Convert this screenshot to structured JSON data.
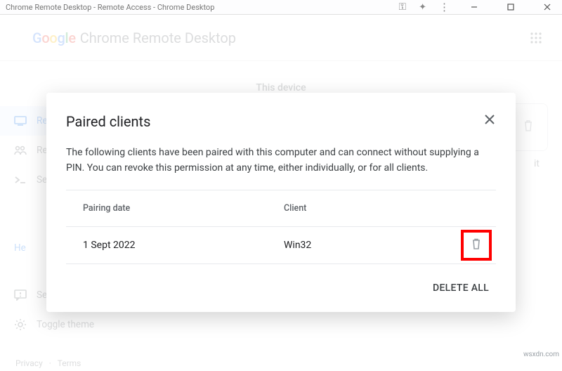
{
  "window": {
    "title": "Chrome Remote Desktop - Remote Access - Chrome Desktop"
  },
  "header": {
    "google": "Google",
    "product": "Chrome Remote Desktop"
  },
  "section": {
    "this_device": "This device"
  },
  "sidebar": {
    "items": [
      {
        "label": "Re"
      },
      {
        "label": "Re"
      },
      {
        "label": "Se"
      }
    ],
    "help": "He",
    "item4": "Se",
    "toggle": "Toggle theme"
  },
  "card": {
    "edit": "it"
  },
  "dialog": {
    "title": "Paired clients",
    "description": "The following clients have been paired with this computer and can connect without supplying a PIN. You can revoke this permission at any time, either individually, or for all clients.",
    "col_date": "Pairing date",
    "col_client": "Client",
    "rows": [
      {
        "date": "1 Sept 2022",
        "client": "Win32"
      }
    ],
    "delete_all": "DELETE ALL"
  },
  "footer": {
    "privacy": "Privacy",
    "terms": "Terms"
  },
  "watermark": "wsxdn.com"
}
